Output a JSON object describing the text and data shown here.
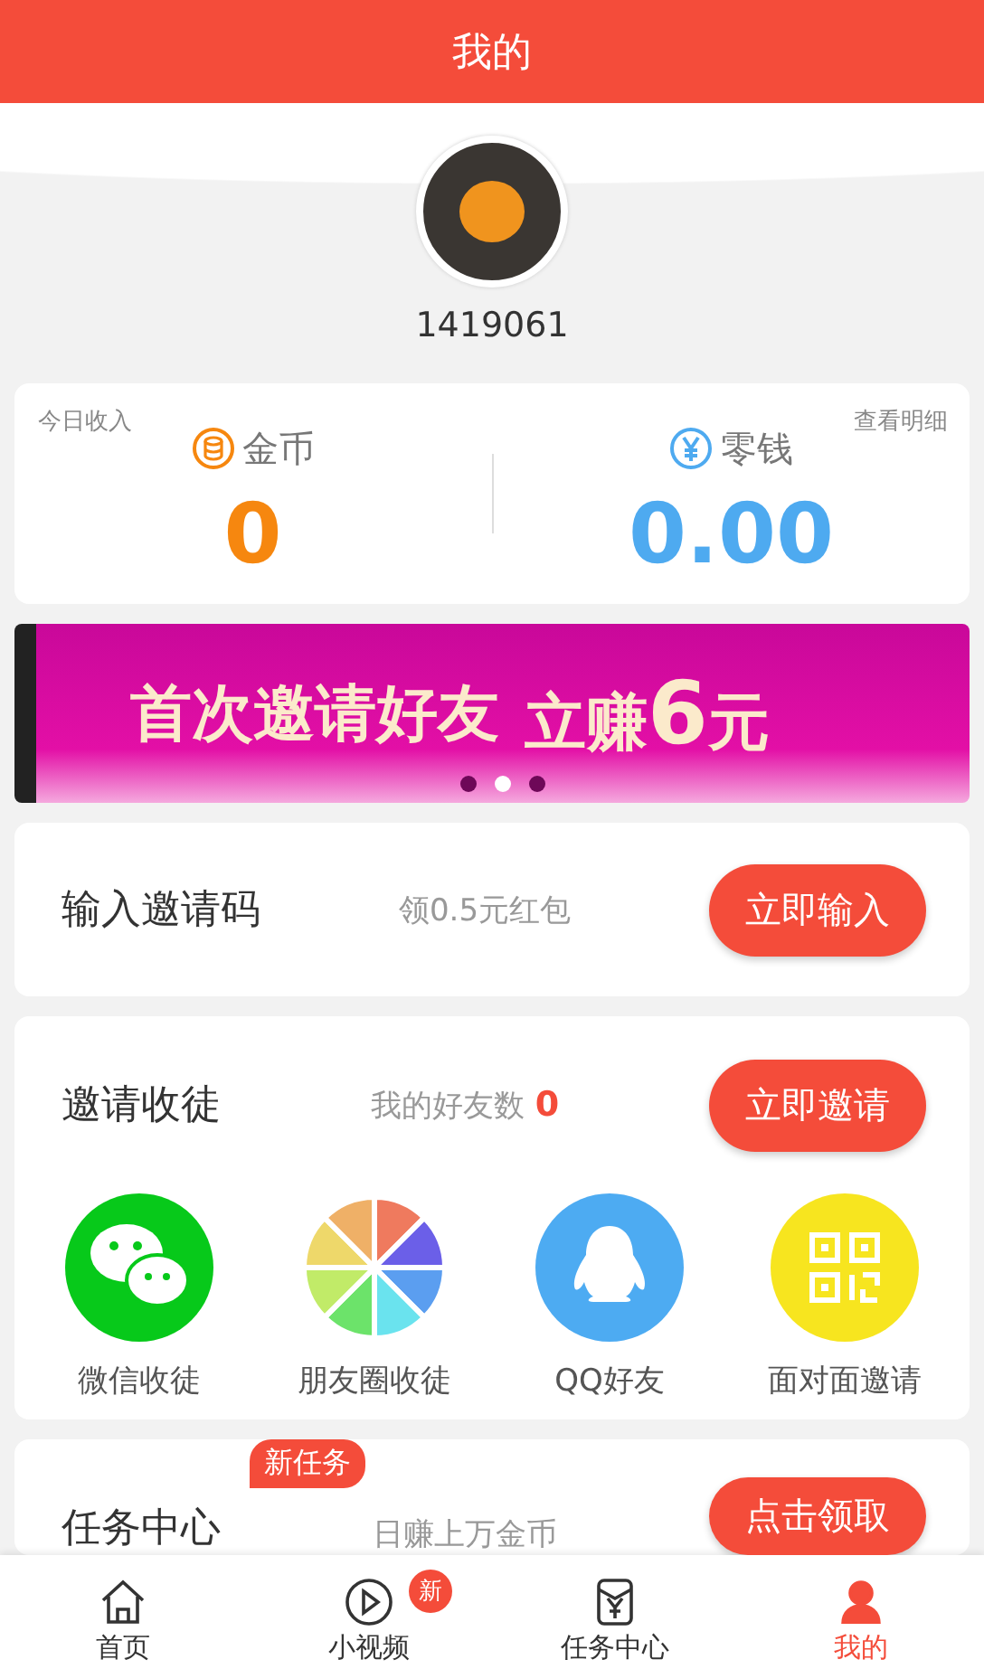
{
  "header": {
    "title": "我的"
  },
  "profile": {
    "user_id": "1419061"
  },
  "earnings": {
    "label": "今日收入",
    "detail_link": "查看明细",
    "coins": {
      "label": "金币",
      "value": "0"
    },
    "cash": {
      "label": "零钱",
      "value": "0.00"
    }
  },
  "banner": {
    "headline": "首次邀请好友",
    "offer_prefix": "立赚",
    "offer_amount": "6",
    "offer_suffix": "元",
    "dots": [
      {
        "selected": false
      },
      {
        "selected": true
      },
      {
        "selected": false
      }
    ]
  },
  "invite_code": {
    "title": "输入邀请码",
    "reward": "领0.5元红包",
    "button": "立即输入"
  },
  "recruit": {
    "title": "邀请收徒",
    "friends_label": "我的好友数",
    "friends_count": "0",
    "button": "立即邀请",
    "share_options": [
      {
        "kind": "wechat",
        "label": "微信收徒"
      },
      {
        "kind": "moments",
        "label": "朋友圈收徒"
      },
      {
        "kind": "qq",
        "label": "QQ好友"
      },
      {
        "kind": "qrcode",
        "label": "面对面邀请"
      }
    ]
  },
  "task_center": {
    "title": "任务中心",
    "badge": "新任务",
    "subtitle": "日赚上万金币",
    "button": "点击领取"
  },
  "tab_bar": [
    {
      "kind": "home",
      "label": "首页",
      "selected": false
    },
    {
      "kind": "video",
      "label": "小视频",
      "selected": false,
      "badge": "新"
    },
    {
      "kind": "tasks",
      "label": "任务中心",
      "selected": false
    },
    {
      "kind": "profile",
      "label": "我的",
      "selected": true
    }
  ]
}
